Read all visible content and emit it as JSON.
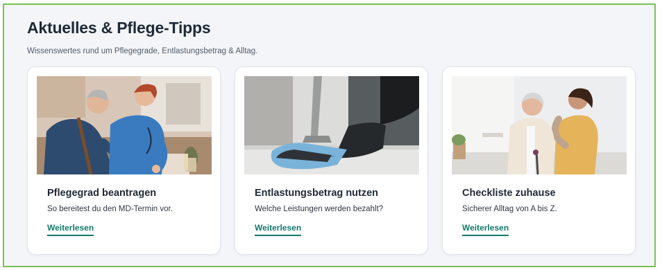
{
  "section": {
    "title": "Aktuelles & Pflege-Tipps",
    "subtitle": "Wissenswertes rund um Pflegegrade, Entlastungsbetrag & Alltag."
  },
  "cards": [
    {
      "title": "Pflegegrad beantragen",
      "text": "So bereitest du den MD-Termin vor.",
      "link": "Weiterlesen"
    },
    {
      "title": "Entlastungsbetrag nutzen",
      "text": "Welche Leistungen werden bezahlt?",
      "link": "Weiterlesen"
    },
    {
      "title": "Checkliste zuhause",
      "text": "Sicherer Alltag von A bis Z.",
      "link": "Weiterlesen"
    }
  ],
  "colors": {
    "frame_border": "#79c251",
    "background": "#f3f5f8",
    "link": "#117a6b",
    "heading": "#1f2a37"
  }
}
